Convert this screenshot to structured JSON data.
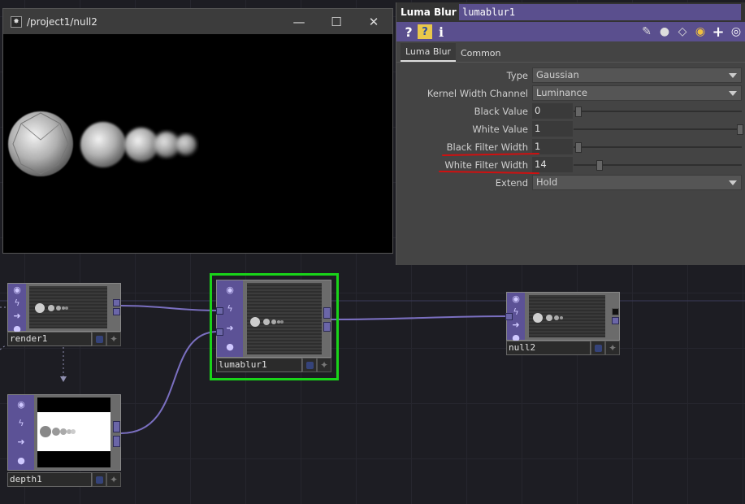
{
  "viewer": {
    "title": "/project1/null2",
    "controls": {
      "minimize": "—",
      "maximize": "☐",
      "close": "✕"
    },
    "app_icon": "td-logo-icon"
  },
  "params": {
    "op_type": "Luma Blur",
    "op_name": "lumablur1",
    "toolbar_icons": [
      "help-icon",
      "python-help-icon",
      "info-icon",
      "edit-icon",
      "comment-icon",
      "tag-icon",
      "python-icon",
      "add-icon",
      "target-icon"
    ],
    "tabs": [
      {
        "label": "Luma Blur",
        "active": true
      },
      {
        "label": "Common",
        "active": false
      }
    ],
    "rows": [
      {
        "label": "Type",
        "kind": "menu",
        "value": "Gaussian"
      },
      {
        "label": "Kernel Width Channel",
        "kind": "menu",
        "value": "Luminance"
      },
      {
        "label": "Black Value",
        "kind": "slider",
        "value": "0",
        "level": 0.0
      },
      {
        "label": "White Value",
        "kind": "slider",
        "value": "1",
        "level": 1.0
      },
      {
        "label": "Black Filter Width",
        "kind": "slider",
        "value": "1",
        "level": 0.0,
        "underlined": true
      },
      {
        "label": "White Filter Width",
        "kind": "slider",
        "value": "14",
        "level": 0.13,
        "underlined": true
      },
      {
        "label": "Extend",
        "kind": "menu",
        "value": "Hold"
      }
    ]
  },
  "nodes": {
    "render1": {
      "name": "render1"
    },
    "lumablur1": {
      "name": "lumablur1",
      "selected": true
    },
    "null2": {
      "name": "null2"
    },
    "depth1": {
      "name": "depth1"
    }
  },
  "colors": {
    "accent_purple": "#5a4f8e",
    "selection_green": "#19d419",
    "wire": "#7a6fc0",
    "underline_red": "#d01010"
  }
}
